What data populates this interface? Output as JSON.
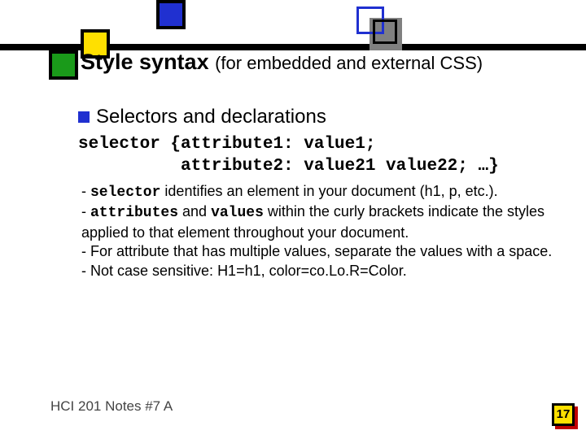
{
  "title_main": "Style syntax",
  "title_paren": "(for embedded and external CSS)",
  "subheading": "Selectors and declarations",
  "code_line1": "selector {attribute1: value1;",
  "code_line2": "          attribute2: value21 value22; …}",
  "notes": {
    "l1a": "- ",
    "l1b": "selector",
    "l1c": " identifies an element in your document (h1, p, etc.).",
    "l2a": "- ",
    "l2b": "attributes",
    "l2c": " and ",
    "l2d": "values",
    "l2e": " within the curly brackets indicate the styles applied to that element throughout your document.",
    "l3": "- For attribute that has multiple values, separate the values with a space.",
    "l4": "- Not case sensitive: H1=h1, color=co.Lo.R=Color."
  },
  "footer": "HCI 201 Notes #7 A",
  "page_number": "17"
}
